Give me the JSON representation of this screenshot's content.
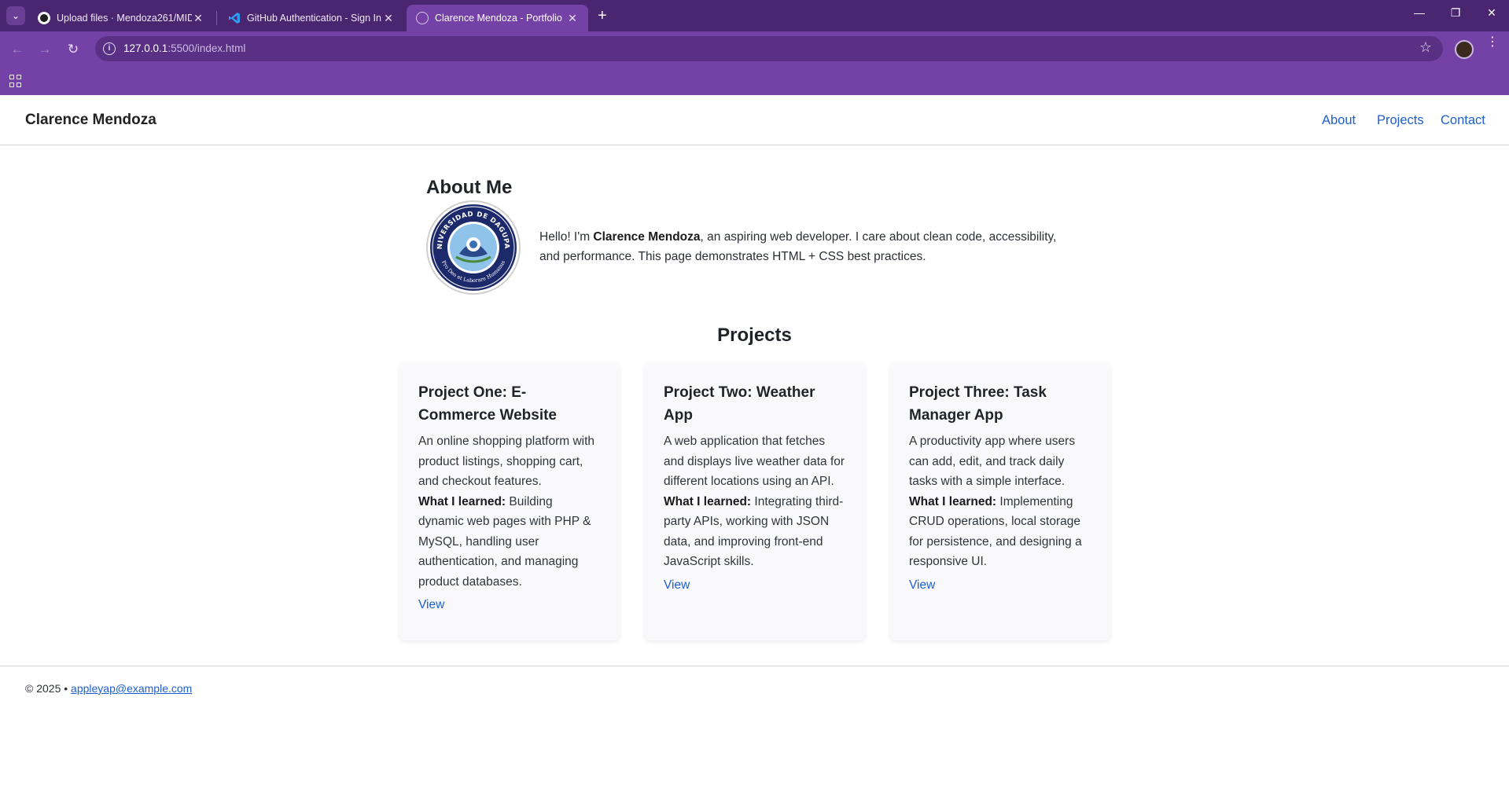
{
  "browser": {
    "tabs": [
      {
        "title": "Upload files · Mendoza261/MID",
        "icon": "github-icon"
      },
      {
        "title": "GitHub Authentication - Sign In",
        "icon": "vscode-icon"
      },
      {
        "title": "Clarence Mendoza - Portfolio",
        "icon": "globe-icon",
        "active": true
      }
    ],
    "url_host": "127.0.0.1",
    "url_path": ":5500/index.html",
    "accent_color": "#7442a6"
  },
  "site": {
    "brand": "Clarence Mendoza",
    "nav": [
      "About",
      "Projects",
      "Contact"
    ]
  },
  "about": {
    "title": "About Me",
    "intro_prefix": "Hello! I'm ",
    "name": "Clarence Mendoza",
    "intro_suffix": ", an aspiring web developer. I care about clean code, accessibility, and performance. This page demonstrates HTML + CSS best practices.",
    "logo_text_top": "UNIVERSIDAD DE DAGUPAN",
    "logo_text_bottom": "Pro Deo et Laborare Humanus"
  },
  "projects": {
    "title": "Projects",
    "learned_label": "What I learned:",
    "view_label": "View",
    "items": [
      {
        "title": "Project One: E-Commerce Website",
        "description": "An online shopping platform with product listings, shopping cart, and checkout features.",
        "learned": " Building dynamic web pages with PHP & MySQL, handling user authentication, and managing product databases."
      },
      {
        "title": "Project Two: Weather App",
        "description": "A web application that fetches and displays live weather data for different locations using an API.",
        "learned": " Integrating third-party APIs, working with JSON data, and improving front-end JavaScript skills."
      },
      {
        "title": "Project Three: Task Manager App",
        "description": "A productivity app where users can add, edit, and track daily tasks with a simple interface.",
        "learned": " Implementing CRUD operations, local storage for persistence, and designing a responsive UI."
      }
    ]
  },
  "footer": {
    "prefix": "© 2025 • ",
    "email": "appleyap@example.com"
  }
}
